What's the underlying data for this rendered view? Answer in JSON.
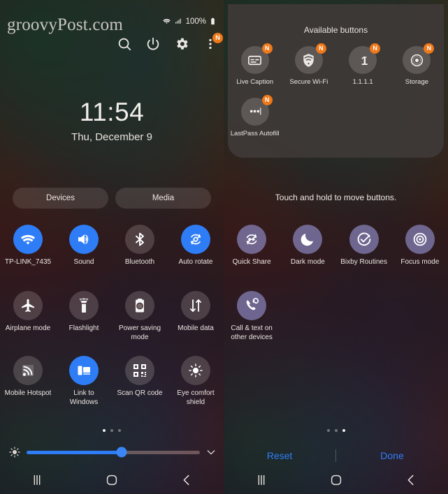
{
  "watermark": "groovyPost.com",
  "left_panel": {
    "status_bar": {
      "battery_percent": "100%",
      "icons": [
        "wifi-icon",
        "signal-icon",
        "battery-icon"
      ]
    },
    "header_icons": [
      {
        "name": "search-icon",
        "badge": ""
      },
      {
        "name": "power-icon",
        "badge": ""
      },
      {
        "name": "settings-gear-icon",
        "badge": ""
      },
      {
        "name": "overflow-menu-icon",
        "badge": "N"
      }
    ],
    "clock": {
      "time": "11:54",
      "date": "Thu, December 9"
    },
    "pills": [
      {
        "label": "Devices"
      },
      {
        "label": "Media"
      }
    ],
    "toggles": [
      [
        {
          "label": "TP-LINK_7435",
          "icon": "wifi-icon",
          "state": "on"
        },
        {
          "label": "Sound",
          "icon": "sound-icon",
          "state": "on"
        },
        {
          "label": "Bluetooth",
          "icon": "bluetooth-icon",
          "state": "off"
        },
        {
          "label": "Auto rotate",
          "icon": "auto-rotate-icon",
          "state": "on"
        }
      ],
      [
        {
          "label": "Airplane mode",
          "icon": "airplane-icon",
          "state": "off"
        },
        {
          "label": "Flashlight",
          "icon": "flashlight-icon",
          "state": "off"
        },
        {
          "label": "Power saving mode",
          "icon": "power-saving-icon",
          "state": "off"
        },
        {
          "label": "Mobile data",
          "icon": "mobile-data-icon",
          "state": "off"
        }
      ],
      [
        {
          "label": "Mobile Hotspot",
          "icon": "hotspot-icon",
          "state": "off"
        },
        {
          "label": "Link to Windows",
          "icon": "link-to-windows-icon",
          "state": "on"
        },
        {
          "label": "Scan QR code",
          "icon": "qr-code-icon",
          "state": "off"
        },
        {
          "label": "Eye comfort shield",
          "icon": "eye-comfort-icon",
          "state": "off"
        }
      ]
    ],
    "page_dots": {
      "count": 3,
      "active_index": 0
    },
    "brightness": {
      "value_percent": 55,
      "icon": "brightness-icon",
      "expand_icon": "chevron-down-icon"
    },
    "nav_bar": [
      {
        "name": "recents-button",
        "icon": "recents-icon"
      },
      {
        "name": "home-button",
        "icon": "home-icon"
      },
      {
        "name": "back-button",
        "icon": "back-icon"
      }
    ]
  },
  "right_panel": {
    "available_title": "Available buttons",
    "available_buttons": [
      [
        {
          "label": "Live Caption",
          "icon": "live-caption-icon",
          "badge": "N"
        },
        {
          "label": "Secure Wi-Fi",
          "icon": "secure-wifi-icon",
          "badge": "N"
        },
        {
          "label": "1.1.1.1",
          "icon": "one-one-one-one-icon",
          "badge": "N"
        },
        {
          "label": "Storage",
          "icon": "storage-icon",
          "badge": "N"
        }
      ],
      [
        {
          "label": "LastPass Autofill",
          "icon": "lastpass-icon",
          "badge": "N"
        }
      ]
    ],
    "hint": "Touch and hold to move buttons.",
    "toggles": [
      [
        {
          "label": "Quick Share",
          "icon": "quick-share-icon",
          "state": "mode"
        },
        {
          "label": "Dark mode",
          "icon": "dark-mode-icon",
          "state": "mode"
        },
        {
          "label": "Bixby Routines",
          "icon": "bixby-routines-icon",
          "state": "mode"
        },
        {
          "label": "Focus mode",
          "icon": "focus-mode-icon",
          "state": "mode"
        }
      ],
      [
        {
          "label": "Call & text on other devices",
          "icon": "call-text-other-devices-icon",
          "state": "mode"
        }
      ]
    ],
    "page_dots": {
      "count": 3,
      "active_index": 2
    },
    "actions": {
      "reset_label": "Reset",
      "done_label": "Done"
    },
    "nav_bar": [
      {
        "name": "recents-button",
        "icon": "recents-icon"
      },
      {
        "name": "home-button",
        "icon": "home-icon"
      },
      {
        "name": "back-button",
        "icon": "back-icon"
      }
    ]
  },
  "colors": {
    "accent_blue": "#2e7df6",
    "badge_orange": "#f07818",
    "action_blue": "#2f7ef5",
    "mode_purple": "#7e78a8"
  }
}
